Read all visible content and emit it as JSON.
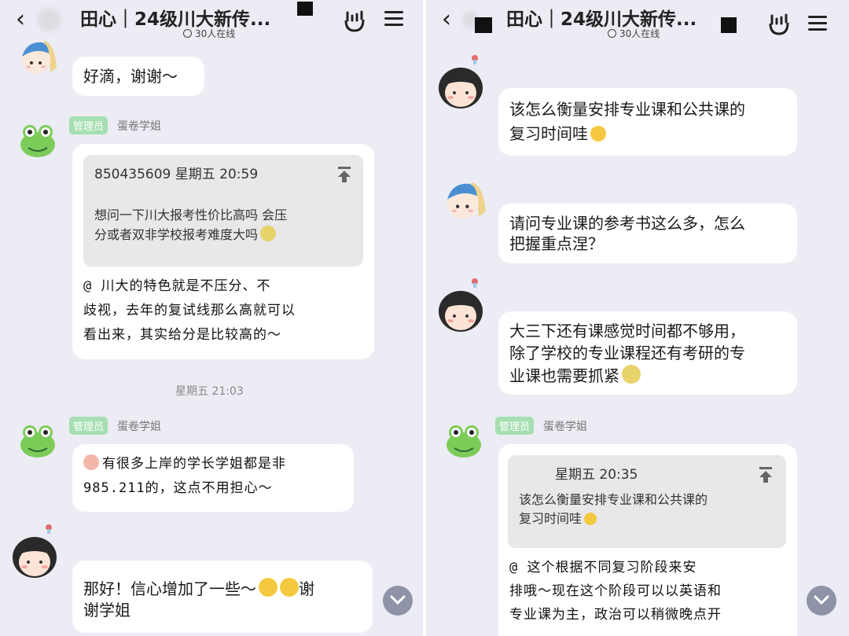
{
  "left": {
    "header": {
      "title": "田心｜24级川大新传...",
      "online": "30人在线"
    },
    "messages": {
      "m1": {
        "text": "好滴，谢谢～"
      },
      "m2": {
        "badge": "管理员",
        "sender": "蛋卷学姐",
        "quote_header": "850435609 星期五 20:59",
        "quote_line1": "想问一下川大报考性价比高吗  会压",
        "quote_line2": "分或者双非学校报考难度大吗",
        "reply_line1": "@        川大的特色就是不压分、不",
        "reply_line2": "歧视，去年的复试线那么高就可以",
        "reply_line3": "看出来，其实给分是比较高的～"
      },
      "timestamp": "星期五 21:03",
      "m3": {
        "badge": "管理员",
        "sender": "蛋卷学姐",
        "line1": "有很多上岸的学长学姐都是非",
        "line2": "985.211的，这点不用担心～"
      },
      "m4": {
        "line1": "那好！信心增加了一些～",
        "line1_tail": "谢",
        "line2": "谢学姐"
      }
    }
  },
  "right": {
    "header": {
      "title": "田心｜24级川大新传...",
      "online": "30人在线"
    },
    "messages": {
      "m1": {
        "line1": "该怎么衡量安排专业课和公共课的",
        "line2": "复习时间哇"
      },
      "m2": {
        "line1": "请问专业课的参考书这么多，怎么",
        "line2": "把握重点涅？"
      },
      "m3": {
        "line1": "大三下还有课感觉时间都不够用，",
        "line2": "除了学校的专业课程还有考研的专",
        "line3": "业课也需要抓紧"
      },
      "m4": {
        "badge": "管理员",
        "sender": "蛋卷学姐",
        "quote_header": "星期五 20:35",
        "quote_line1": "该怎么衡量安排专业课和公共课的",
        "quote_line2": "复习时间哇",
        "reply_line1": "@        这个根据不同复习阶段来安",
        "reply_line2": "排哦～现在这个阶段可以以英语和",
        "reply_line3": "专业课为主，政治可以稍微晚点开"
      }
    }
  },
  "colors": {
    "background": "#ECECF4",
    "badge": "#a6dfb2",
    "bubble": "#ffffff",
    "scroll_button": "#8f93a8"
  },
  "icons": [
    "back-arrow-icon",
    "online-people-icon",
    "rock-hand-icon",
    "menu-icon",
    "pin-up-arrow-icon",
    "scroll-down-icon"
  ]
}
